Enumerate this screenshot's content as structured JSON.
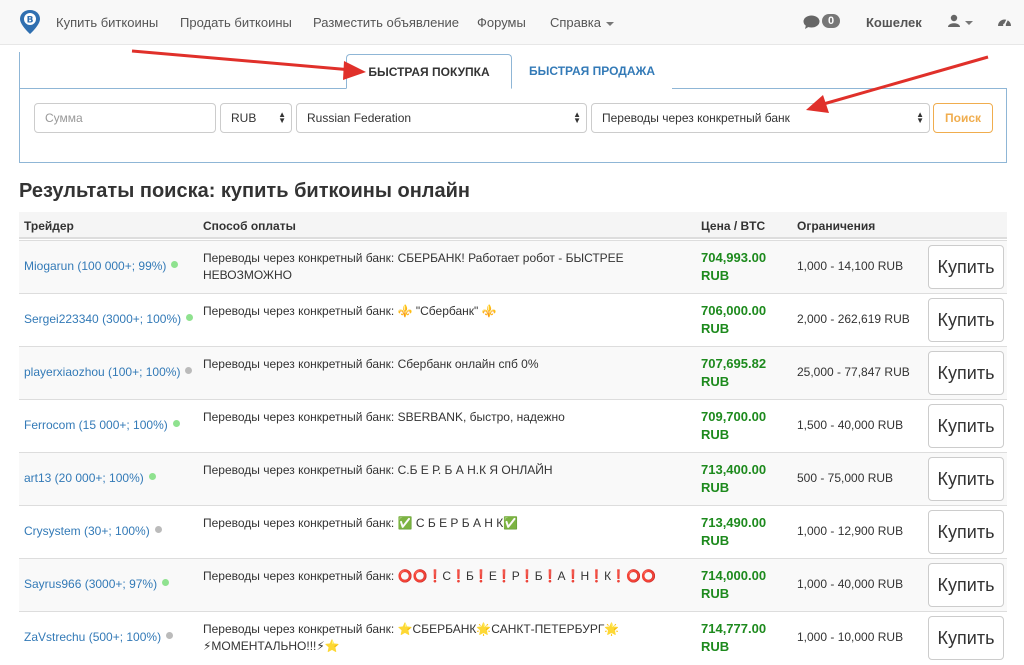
{
  "navbar": {
    "links": [
      "Купить биткоины",
      "Продать биткоины",
      "Разместить объявление",
      "Форумы",
      "Справка"
    ],
    "messages_count": "0",
    "wallet": "Кошелек"
  },
  "tabs": {
    "active": "БЫСТРАЯ ПОКУПКА",
    "inactive": "БЫСТРАЯ ПРОДАЖА"
  },
  "search": {
    "amount_placeholder": "Сумма",
    "currency": "RUB",
    "country": "Russian Federation",
    "payment_method": "Переводы через конкретный банк",
    "button": "Поиск"
  },
  "results_title": "Результаты поиска: купить биткоины онлайн",
  "table": {
    "headers": {
      "trader": "Трейдер",
      "payment": "Способ оплаты",
      "price": "Цена / BTC",
      "limits": "Ограничения"
    },
    "buy_label": "Купить",
    "rows": [
      {
        "trader": "Miogarun (100 000+; 99%)",
        "online": true,
        "payment": "Переводы через конкретный банк: СБЕРБАНК! Работает робот - БЫСТРЕЕ НЕВОЗМОЖНО",
        "price": "704,993.00",
        "currency": "RUB",
        "limits": "1,000 - 14,100 RUB"
      },
      {
        "trader": "Sergei223340 (3000+; 100%)",
        "online": true,
        "payment": "Переводы через конкретный банк: ⚜️ \"Сбербанк\" ⚜️",
        "price": "706,000.00",
        "currency": "RUB",
        "limits": "2,000 - 262,619 RUB"
      },
      {
        "trader": "playerxiaozhou (100+; 100%)",
        "online": false,
        "payment": "Переводы через конкретный банк: Сбербанк онлайн спб 0%",
        "price": "707,695.82",
        "currency": "RUB",
        "limits": "25,000 - 77,847 RUB"
      },
      {
        "trader": "Ferrocom (15 000+; 100%)",
        "online": true,
        "payment": "Переводы через конкретный банк: SBERBANK, быстро, надежно",
        "price": "709,700.00",
        "currency": "RUB",
        "limits": "1,500 - 40,000 RUB"
      },
      {
        "trader": "art13 (20 000+; 100%)",
        "online": true,
        "payment": "Переводы через конкретный банк: С.Б Е Р. Б А Н.К Я ОНЛАЙН",
        "price": "713,400.00",
        "currency": "RUB",
        "limits": "500 - 75,000 RUB"
      },
      {
        "trader": "Crysystem (30+; 100%)",
        "online": false,
        "payment": "Переводы через конкретный банк: ✅ С Б Е Р Б А Н К✅",
        "price": "713,490.00",
        "currency": "RUB",
        "limits": "1,000 - 12,900 RUB"
      },
      {
        "trader": "Sayrus966 (3000+; 97%)",
        "online": true,
        "payment": "Переводы через конкретный банк: ⭕⭕❗С❗Б❗Е❗Р❗Б❗А❗Н❗К❗⭕⭕",
        "price": "714,000.00",
        "currency": "RUB",
        "limits": "1,000 - 40,000 RUB"
      },
      {
        "trader": "ZaVstrechu (500+; 100%)",
        "online": false,
        "payment": "Переводы через конкретный банк: ⭐СБЕРБАНК🌟САНКТ-ПЕТЕРБУРГ🌟⚡МОМЕНТАЛЬНО!!!⚡⭐",
        "price": "714,777.00",
        "currency": "RUB",
        "limits": "1,000 - 10,000 RUB"
      }
    ]
  },
  "colors": {
    "accent": "#337ab7",
    "price": "#1d8a1d",
    "search_button": "#f0ad4e",
    "annotation_arrow": "#e0302a"
  }
}
